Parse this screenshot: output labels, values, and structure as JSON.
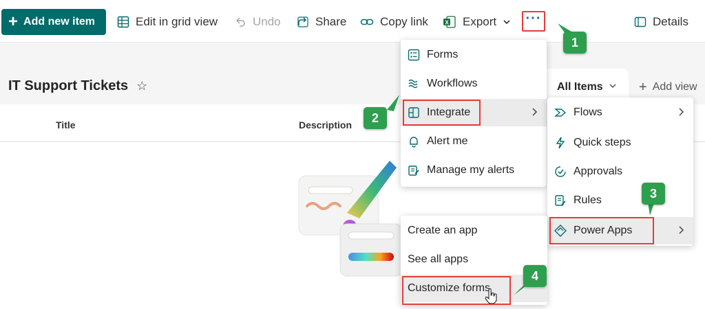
{
  "toolbar": {
    "add_new_item": "Add new item",
    "edit_grid": "Edit in grid view",
    "undo": "Undo",
    "share": "Share",
    "copy_link": "Copy link",
    "export": "Export",
    "more": "···",
    "details": "Details"
  },
  "list": {
    "title": "IT Support Tickets",
    "columns": [
      "Title",
      "Description"
    ],
    "view_name": "All Items",
    "add_view": "Add view"
  },
  "more_menu": {
    "items": [
      "Forms",
      "Workflows",
      "Integrate",
      "Alert me",
      "Manage my alerts"
    ]
  },
  "integrate_menu": {
    "items": [
      "Flows",
      "Quick steps",
      "Approvals",
      "Rules",
      "Power Apps"
    ]
  },
  "powerapps_menu": {
    "items": [
      "Create an app",
      "See all apps",
      "Customize forms"
    ]
  },
  "callouts": [
    "1",
    "2",
    "3",
    "4"
  ],
  "colors": {
    "brand": "#046b6b",
    "accent": "#0f6cbd",
    "highlight": "#e63b3b",
    "callout": "#2e9e4f"
  }
}
